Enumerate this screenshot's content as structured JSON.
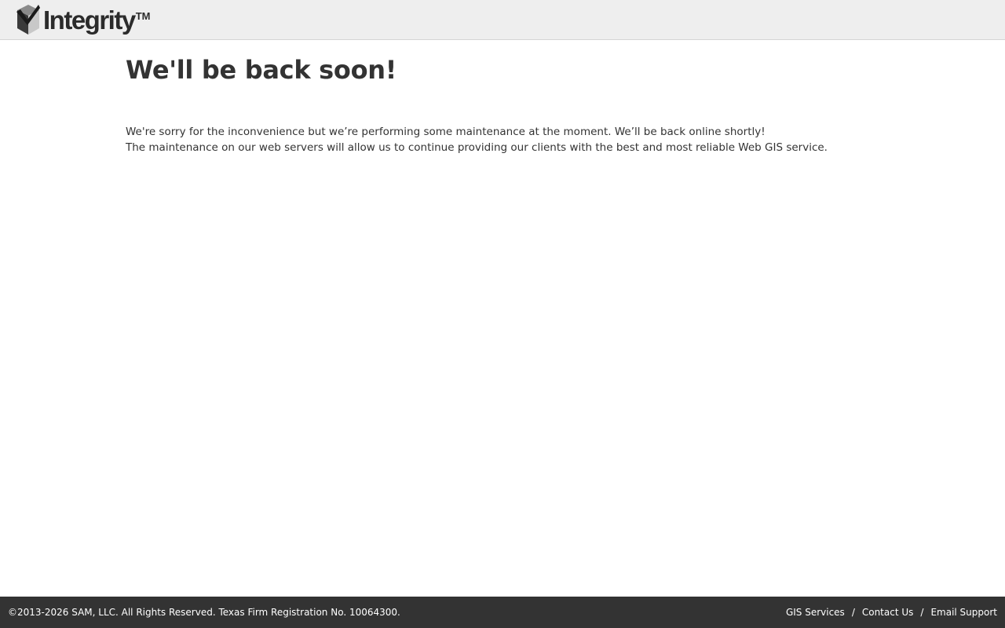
{
  "header": {
    "logo_text": "Integrity",
    "logo_tm": "TM",
    "logo_icon": "cube-check-icon"
  },
  "main": {
    "headline": "We'll be back soon!",
    "message_line1": "We're sorry for the inconvenience but we’re performing some maintenance at the moment. We’ll be back online shortly!",
    "message_line2": "The maintenance on our web servers will allow us to continue providing our clients with the best and most reliable Web GIS service."
  },
  "footer": {
    "copyright": "©2013-2026 SAM, LLC. All Rights Reserved. Texas Firm Registration No. 10064300.",
    "links": [
      {
        "label": "GIS Services"
      },
      {
        "label": "Contact Us"
      },
      {
        "label": "Email Support"
      }
    ],
    "separator": "/"
  },
  "colors": {
    "header_bg": "#eeeeee",
    "footer_bg": "#333333",
    "text": "#333333"
  }
}
